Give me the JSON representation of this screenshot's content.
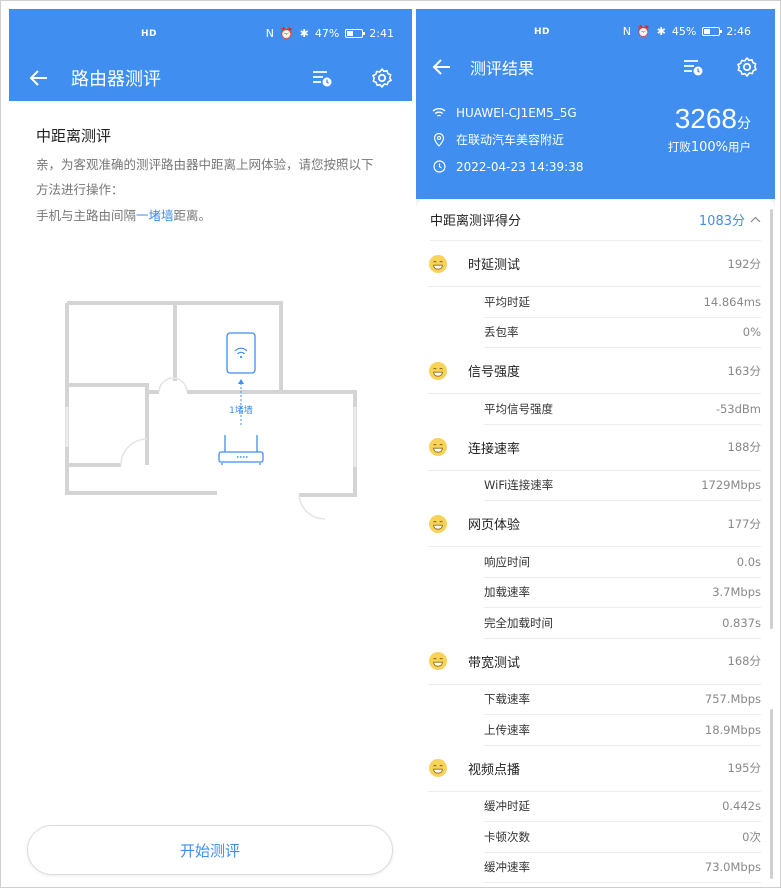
{
  "left": {
    "status": {
      "net": "HD",
      "battery": "47%",
      "time": "2:41"
    },
    "title": "路由器测评",
    "heading": "中距离测评",
    "description": "亲，为客观准确的测评路由器中距离上网体验，请您按照以下方法进行操作：",
    "hint_prefix": "手机与主路由间隔",
    "hint_highlight": "一堵墙",
    "hint_suffix": "距离。",
    "diagram_label": "1堵墙",
    "start_button": "开始测评"
  },
  "right": {
    "status": {
      "net": "HD",
      "battery": "45%",
      "time": "2:46"
    },
    "title": "测评结果",
    "wifi_name": "HUAWEI-CJ1EM5_5G",
    "location": "在联动汽车美容附近",
    "datetime": "2022-04-23 14:39:38",
    "total_score": "3268",
    "total_unit": "分",
    "beat_prefix": "打败",
    "beat_percent": "100%",
    "beat_suffix": "用户",
    "summary_label": "中距离测评得分",
    "summary_value": "1083分",
    "categories": [
      {
        "name": "时延测试",
        "score": "192分",
        "items": [
          {
            "name": "平均时延",
            "value": "14.864ms"
          },
          {
            "name": "丢包率",
            "value": "0%"
          }
        ]
      },
      {
        "name": "信号强度",
        "score": "163分",
        "items": [
          {
            "name": "平均信号强度",
            "value": "-53dBm"
          }
        ]
      },
      {
        "name": "连接速率",
        "score": "188分",
        "items": [
          {
            "name": "WiFi连接速率",
            "value": "1729Mbps"
          }
        ]
      },
      {
        "name": "网页体验",
        "score": "177分",
        "items": [
          {
            "name": "响应时间",
            "value": "0.0s"
          },
          {
            "name": "加载速率",
            "value": "3.7Mbps"
          },
          {
            "name": "完全加载时间",
            "value": "0.837s"
          }
        ]
      },
      {
        "name": "带宽测试",
        "score": "168分",
        "items": [
          {
            "name": "下载速率",
            "value": "757.Mbps"
          },
          {
            "name": "上传速率",
            "value": "18.9Mbps"
          }
        ]
      },
      {
        "name": "视频点播",
        "score": "195分",
        "items": [
          {
            "name": "缓冲时延",
            "value": "0.442s"
          },
          {
            "name": "卡顿次数",
            "value": "0次"
          },
          {
            "name": "缓冲速率",
            "value": "73.0Mbps"
          }
        ]
      }
    ]
  },
  "colors": {
    "accent": "#3f8ef0",
    "smile": "#f7d35a"
  }
}
